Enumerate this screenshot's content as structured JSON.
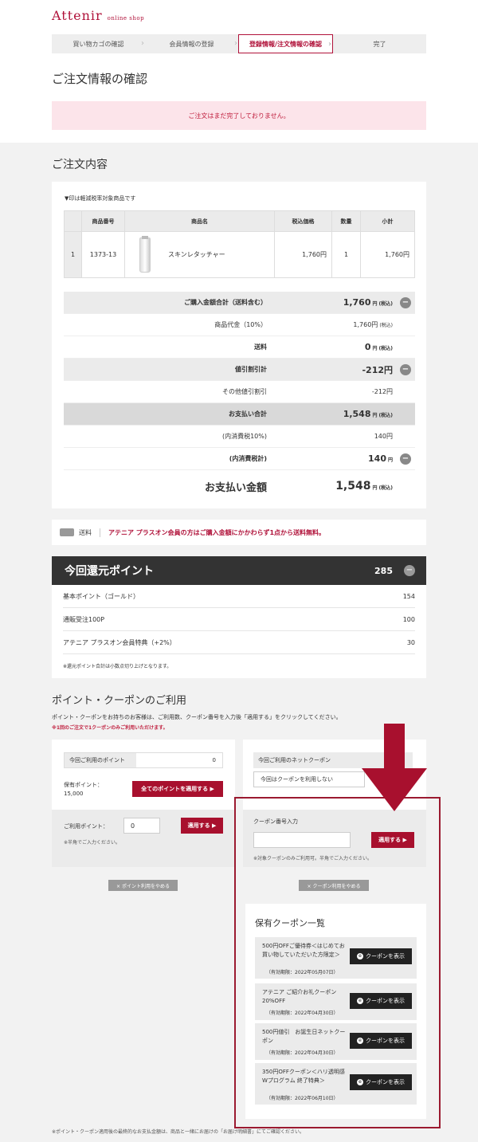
{
  "header": {
    "logo": "Attenir",
    "logo_sub": "online shop"
  },
  "steps": [
    "買い物カゴの確認",
    "会員情報の登録",
    "登録情報/注文情報の確認",
    "完了"
  ],
  "page_title": "ご注文情報の確認",
  "alert": "ご注文はまだ完了しておりません。",
  "order": {
    "section_title": "ご注文内容",
    "note": "▼印は軽減税率対象商品です",
    "columns": [
      "",
      "商品番号",
      "商品名",
      "税込価格",
      "数量",
      "小計"
    ],
    "row": {
      "no": "1",
      "code": "1373-13",
      "name": "スキンレタッチャー",
      "price": "1,760円",
      "qty": "1",
      "subtotal": "1,760円"
    },
    "tax_label": "(税込)",
    "totals": [
      {
        "label": "ご購入金額合計（送料含む）",
        "value": "1,760",
        "unit": "円",
        "tax": "(税込)"
      },
      {
        "label": "商品代金（10%）",
        "value": "1,760円",
        "tax": "(税込)"
      },
      {
        "label": "送料",
        "value": "0",
        "unit": "円",
        "tax": "(税込)"
      },
      {
        "label": "値引割引計",
        "value": "-212円"
      },
      {
        "label": "その他値引割引",
        "value": "-212円"
      },
      {
        "label": "お支払い合計",
        "value": "1,548",
        "unit": "円",
        "tax": "(税込)"
      },
      {
        "label": "(内消費税10%)",
        "value": "140円"
      },
      {
        "label": "(内消費税計)",
        "value": "140",
        "unit": "円"
      },
      {
        "label": "お支払い金額",
        "value": "1,548",
        "unit": "円",
        "tax": "(税込)"
      }
    ]
  },
  "shipping": {
    "label": "送料",
    "message": "アテニア プラスオン会員の方はご購入金額にかかわらず1点から送料無料。"
  },
  "points": {
    "title": "今回還元ポイント",
    "total": "285",
    "rows": [
      {
        "label": "基本ポイント（ゴールド）",
        "value": "154"
      },
      {
        "label": "通販受注100P",
        "value": "100"
      },
      {
        "label": "アテニア プラスオン会員特典（+2%）",
        "value": "30"
      }
    ],
    "note": "※還元ポイント合計は小数点切り上げとなります。"
  },
  "usage": {
    "title": "ポイント・クーポンのご利用",
    "desc": "ポイント・クーポンをお持ちのお客様は、ご利用数、クーポン番号を入力後「適用する」をクリックしてください。",
    "desc_red": "※1回のご注文で1クーポンのみご利用いただけます。",
    "point_label": "今回ご利用のポイント",
    "point_value": "0",
    "owned_label": "保有ポイント：",
    "owned_value": "15,000",
    "apply_all": "全てのポイントを適用する ▶",
    "use_label": "ご利用ポイント：",
    "use_value": "0",
    "apply": "適用する ▶",
    "half_note": "※半角でご入力ください。",
    "cancel_points": "× ポイント利用をやめる",
    "net_coupon_label": "今回ご利用のネットクーポン",
    "net_coupon_value": "今回はクーポンを利用しない",
    "coupon_input_label": "クーポン番号入力",
    "coupon_note": "※対象クーポンのみご利用可。半角でご入力ください。",
    "cancel_coupon": "× クーポン利用をやめる"
  },
  "owned_coupons": {
    "title": "保有クーポン一覧",
    "button": "クーポンを表示",
    "items": [
      {
        "name": "500円OFFご優待券＜はじめてお買い物していただいた方限定＞",
        "expiry": "（有効期限：2022年05月07日）"
      },
      {
        "name": "アテニア ご紹介お礼クーポン 20%OFF",
        "expiry": "（有効期限：2022年04月30日）"
      },
      {
        "name": "500円値引　お誕生日ネットクーポン",
        "expiry": "（有効期限：2022年04月30日）"
      },
      {
        "name": "350円OFFクーポン＜ハリ透明感Wプログラム 終了特典＞",
        "expiry": "（有効期限：2022年06月10日）"
      }
    ]
  },
  "footer_note": "※ポイント・クーポン適用後の最終的なお支払金額は、商品と一緒にお届けの「お届け明細書」にてご確認ください。",
  "colors": {
    "brand": "#b0123a",
    "arrow": "#a8102e",
    "dark": "#333333"
  }
}
